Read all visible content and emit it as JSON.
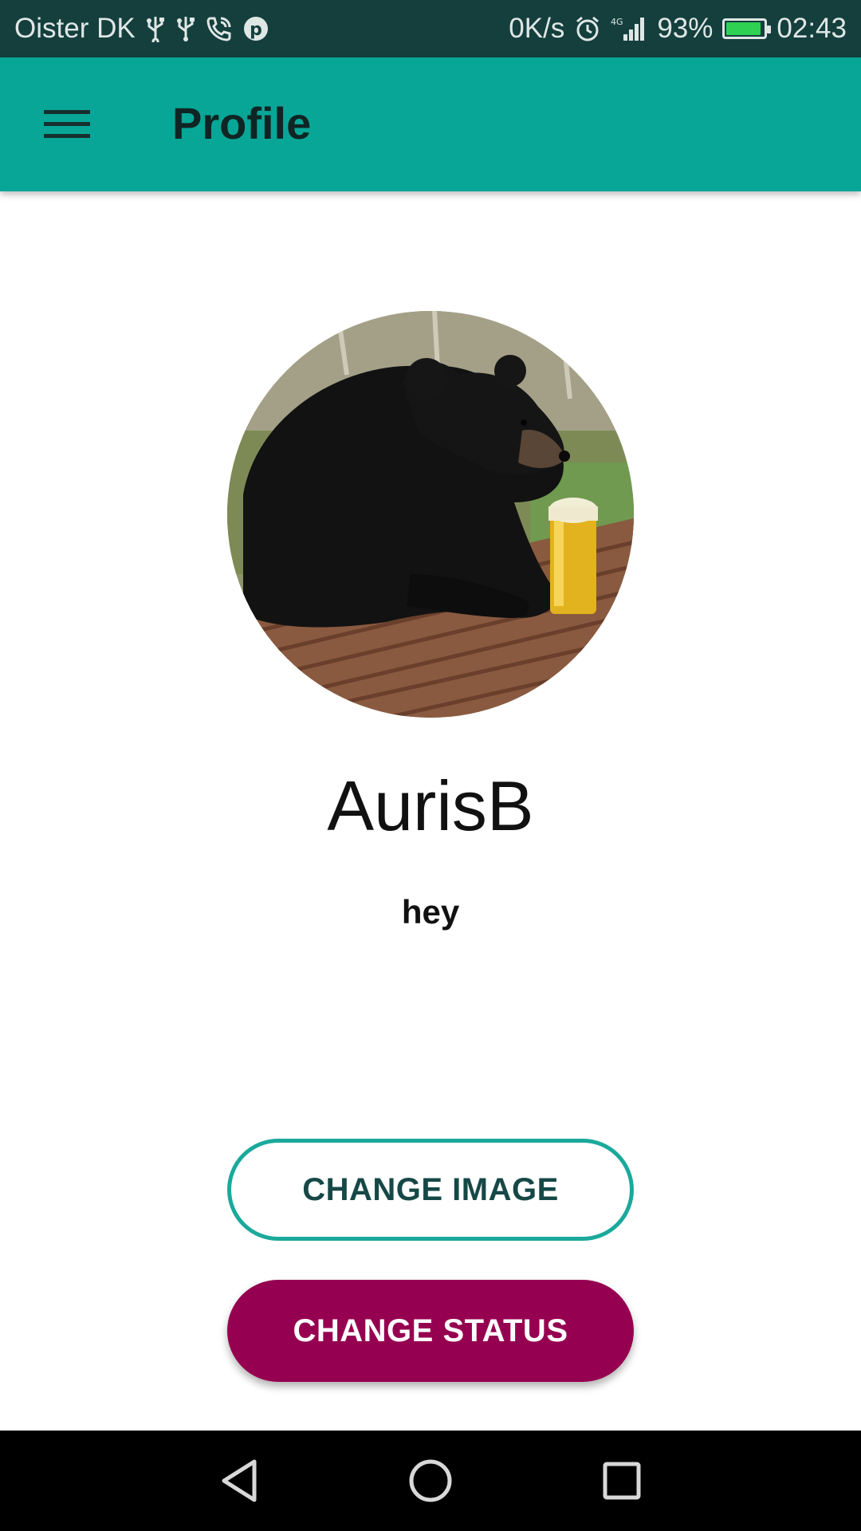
{
  "status_bar": {
    "carrier": "Oister DK",
    "network_speed": "0K/s",
    "battery_percent": "93%",
    "time": "02:43",
    "icons": [
      "usb-icon",
      "usb-icon",
      "wifi-calling-icon",
      "pinterest-icon",
      "alarm-icon",
      "4g-icon",
      "signal-icon",
      "battery-icon"
    ]
  },
  "app_bar": {
    "title": "Profile",
    "menu_icon": "hamburger-menu-icon",
    "background_color": "#08a697"
  },
  "profile": {
    "username": "AurisB",
    "status": "hey",
    "avatar_description_icon": "profile-avatar"
  },
  "actions": {
    "change_image_label": "CHANGE IMAGE",
    "change_status_label": "CHANGE STATUS",
    "change_image_border_color": "#1aa99b",
    "change_status_color": "#960050"
  },
  "nav_bar": {
    "back_icon": "back-triangle-icon",
    "home_icon": "home-circle-icon",
    "recents_icon": "recents-square-icon"
  }
}
